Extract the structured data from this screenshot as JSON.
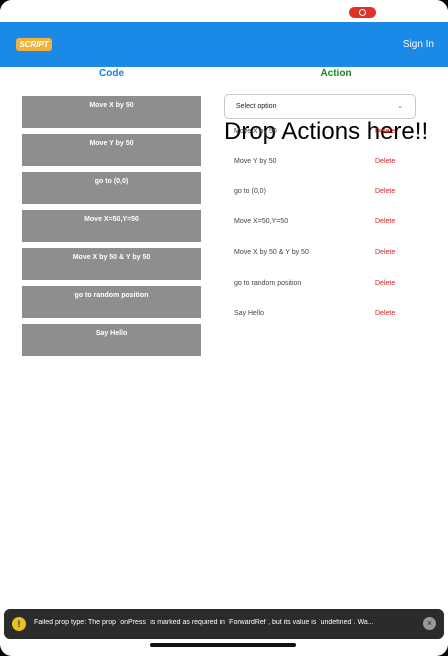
{
  "header": {
    "logo": "SCRIPT",
    "sign_in": "Sign In"
  },
  "columns": {
    "code_title": "Code",
    "action_title": "Action"
  },
  "code_blocks": [
    {
      "label": "Move X by 50"
    },
    {
      "label": "Move Y by 50"
    },
    {
      "label": "go to (0,0)"
    },
    {
      "label": "Move X=50,Y=50"
    },
    {
      "label": "Move X by 50 & Y by 50"
    },
    {
      "label": "go to random position"
    },
    {
      "label": "Say Hello"
    }
  ],
  "action": {
    "drop_text": "Drop Actions here!!",
    "select_placeholder": "Select option",
    "delete_label": "Delete",
    "items": [
      {
        "label": "Move X by 50"
      },
      {
        "label": "Move Y by 50"
      },
      {
        "label": "go to (0,0)"
      },
      {
        "label": "Move X=50,Y=50"
      },
      {
        "label": "Move X by 50 & Y by 50"
      },
      {
        "label": "go to random position"
      },
      {
        "label": "Say Hello"
      }
    ]
  },
  "toast": {
    "message": "Failed prop type: The prop `onPress` is marked as required in `ForwardRef`, but its value is `undefined`. Wa...",
    "icon": "warning-icon",
    "close_icon": "close-icon"
  },
  "colors": {
    "header": "#1a8ae6",
    "code_title": "#1a7fd9",
    "action_title": "#1a8a1a",
    "delete": "#d0232a",
    "code_block": "#8e8e8e"
  }
}
